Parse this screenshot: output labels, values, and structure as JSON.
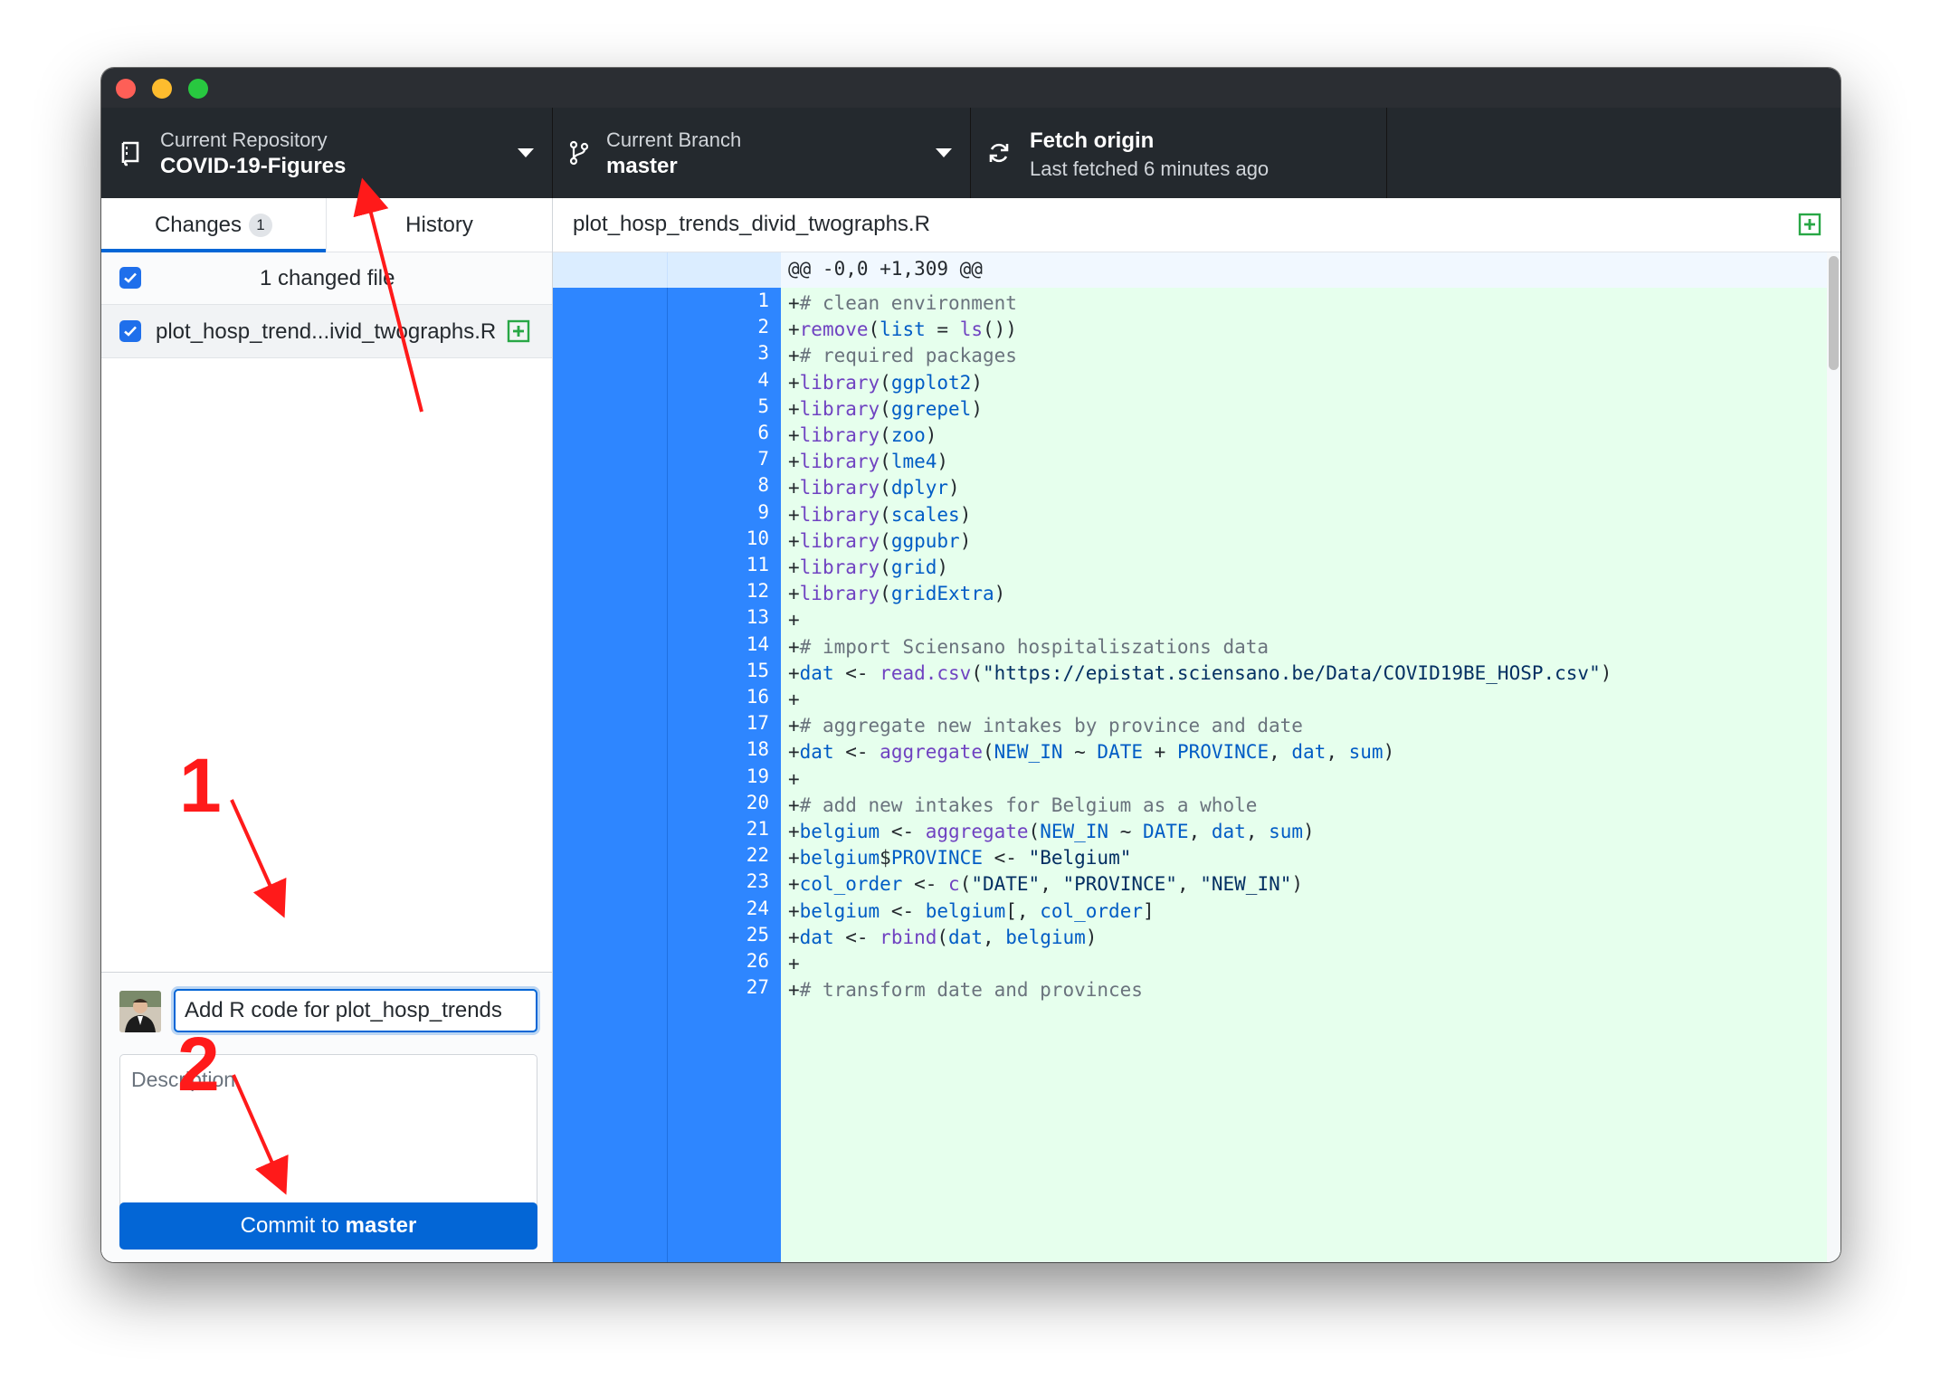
{
  "toolbar": {
    "repo_label": "Current Repository",
    "repo_value": "COVID-19-Figures",
    "branch_label": "Current Branch",
    "branch_value": "master",
    "fetch_label": "Fetch origin",
    "fetch_sub": "Last fetched 6 minutes ago"
  },
  "tabs": {
    "changes": "Changes",
    "changes_count": "1",
    "history": "History"
  },
  "changes": {
    "header": "1 changed file",
    "file_name": "plot_hosp_trend...ivid_twographs.R"
  },
  "commit": {
    "summary_value": "Add R code for plot_hosp_trends",
    "description_placeholder": "Description",
    "button_prefix": "Commit to ",
    "button_branch": "master"
  },
  "diff": {
    "file_name": "plot_hosp_trends_divid_twographs.R",
    "hunk": "@@ -0,0 +1,309 @@",
    "lines": [
      {
        "n": "1",
        "t": "+# clean environment"
      },
      {
        "n": "2",
        "t": "+remove(list = ls())"
      },
      {
        "n": "3",
        "t": "+# required packages"
      },
      {
        "n": "4",
        "t": "+library(ggplot2)"
      },
      {
        "n": "5",
        "t": "+library(ggrepel)"
      },
      {
        "n": "6",
        "t": "+library(zoo)"
      },
      {
        "n": "7",
        "t": "+library(lme4)"
      },
      {
        "n": "8",
        "t": "+library(dplyr)"
      },
      {
        "n": "9",
        "t": "+library(scales)"
      },
      {
        "n": "10",
        "t": "+library(ggpubr)"
      },
      {
        "n": "11",
        "t": "+library(grid)"
      },
      {
        "n": "12",
        "t": "+library(gridExtra)"
      },
      {
        "n": "13",
        "t": "+"
      },
      {
        "n": "14",
        "t": "+# import Sciensano hospitaliszations data"
      },
      {
        "n": "15",
        "t": "+dat <- read.csv(\"https://epistat.sciensano.be/Data/COVID19BE_HOSP.csv\")"
      },
      {
        "n": "16",
        "t": "+"
      },
      {
        "n": "17",
        "t": "+# aggregate new intakes by province and date"
      },
      {
        "n": "18",
        "t": "+dat <- aggregate(NEW_IN ~ DATE + PROVINCE, dat, sum)"
      },
      {
        "n": "19",
        "t": "+"
      },
      {
        "n": "20",
        "t": "+# add new intakes for Belgium as a whole"
      },
      {
        "n": "21",
        "t": "+belgium <- aggregate(NEW_IN ~ DATE, dat, sum)"
      },
      {
        "n": "22",
        "t": "+belgium$PROVINCE <- \"Belgium\""
      },
      {
        "n": "23",
        "t": "+col_order <- c(\"DATE\", \"PROVINCE\", \"NEW_IN\")"
      },
      {
        "n": "24",
        "t": "+belgium <- belgium[, col_order]"
      },
      {
        "n": "25",
        "t": "+dat <- rbind(dat, belgium)"
      },
      {
        "n": "26",
        "t": "+"
      },
      {
        "n": "27",
        "t": "+# transform date and provinces"
      }
    ]
  },
  "annotations": {
    "step1": "1",
    "step2": "2",
    "arrow_color": "#ff1a1a"
  },
  "colors": {
    "toolbar_bg": "#24292e",
    "accent": "#0366d6",
    "diff_added_bg": "#e6ffed",
    "gutter_added": "#2e86ff"
  }
}
